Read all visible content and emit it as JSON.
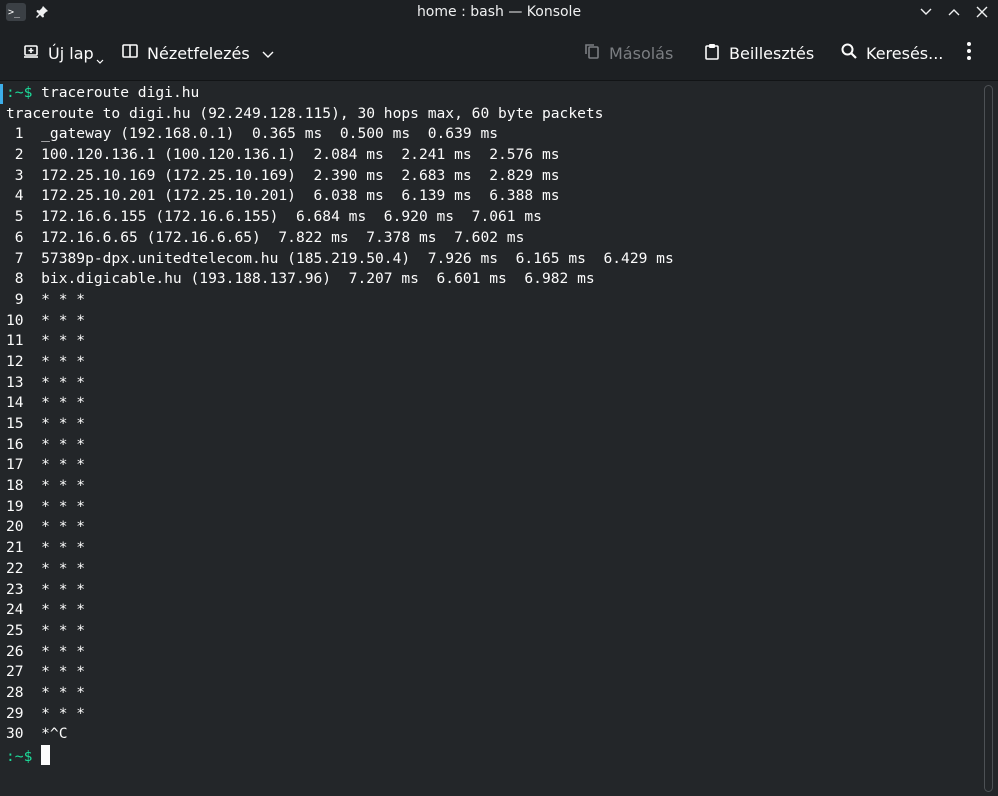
{
  "window": {
    "title": "home : bash — Konsole",
    "app_icon_text": ">_",
    "icons": [
      "konsole-app-icon",
      "pin-icon",
      "minimize-icon",
      "maximize-icon",
      "close-icon"
    ]
  },
  "toolbar": {
    "new_tab": "Új lap",
    "split_view": "Nézetfelezés",
    "copy": "Másolás",
    "paste": "Beillesztés",
    "find": "Keresés..."
  },
  "terminal": {
    "lines": [
      {
        "prompt": ":~$ ",
        "text": "traceroute digi.hu"
      },
      {
        "prompt": "",
        "text": "traceroute to digi.hu (92.249.128.115), 30 hops max, 60 byte packets"
      },
      {
        "prompt": "",
        "text": " 1  _gateway (192.168.0.1)  0.365 ms  0.500 ms  0.639 ms"
      },
      {
        "prompt": "",
        "text": " 2  100.120.136.1 (100.120.136.1)  2.084 ms  2.241 ms  2.576 ms"
      },
      {
        "prompt": "",
        "text": " 3  172.25.10.169 (172.25.10.169)  2.390 ms  2.683 ms  2.829 ms"
      },
      {
        "prompt": "",
        "text": " 4  172.25.10.201 (172.25.10.201)  6.038 ms  6.139 ms  6.388 ms"
      },
      {
        "prompt": "",
        "text": " 5  172.16.6.155 (172.16.6.155)  6.684 ms  6.920 ms  7.061 ms"
      },
      {
        "prompt": "",
        "text": " 6  172.16.6.65 (172.16.6.65)  7.822 ms  7.378 ms  7.602 ms"
      },
      {
        "prompt": "",
        "text": " 7  57389p-dpx.unitedtelecom.hu (185.219.50.4)  7.926 ms  6.165 ms  6.429 ms"
      },
      {
        "prompt": "",
        "text": " 8  bix.digicable.hu (193.188.137.96)  7.207 ms  6.601 ms  6.982 ms"
      },
      {
        "prompt": "",
        "text": " 9  * * *"
      },
      {
        "prompt": "",
        "text": "10  * * *"
      },
      {
        "prompt": "",
        "text": "11  * * *"
      },
      {
        "prompt": "",
        "text": "12  * * *"
      },
      {
        "prompt": "",
        "text": "13  * * *"
      },
      {
        "prompt": "",
        "text": "14  * * *"
      },
      {
        "prompt": "",
        "text": "15  * * *"
      },
      {
        "prompt": "",
        "text": "16  * * *"
      },
      {
        "prompt": "",
        "text": "17  * * *"
      },
      {
        "prompt": "",
        "text": "18  * * *"
      },
      {
        "prompt": "",
        "text": "19  * * *"
      },
      {
        "prompt": "",
        "text": "20  * * *"
      },
      {
        "prompt": "",
        "text": "21  * * *"
      },
      {
        "prompt": "",
        "text": "22  * * *"
      },
      {
        "prompt": "",
        "text": "23  * * *"
      },
      {
        "prompt": "",
        "text": "24  * * *"
      },
      {
        "prompt": "",
        "text": "25  * * *"
      },
      {
        "prompt": "",
        "text": "26  * * *"
      },
      {
        "prompt": "",
        "text": "27  * * *"
      },
      {
        "prompt": "",
        "text": "28  * * *"
      },
      {
        "prompt": "",
        "text": "29  * * *"
      },
      {
        "prompt": "",
        "text": "30  *^C"
      },
      {
        "prompt": ":~$ ",
        "text": "",
        "cursor": true
      }
    ]
  },
  "colors": {
    "background": "#232629",
    "titlebar": "#1d2023",
    "text": "#fcfcfc",
    "prompt": "#1cdc9a",
    "accent": "#3daee9",
    "disabled": "#7b7e82"
  }
}
